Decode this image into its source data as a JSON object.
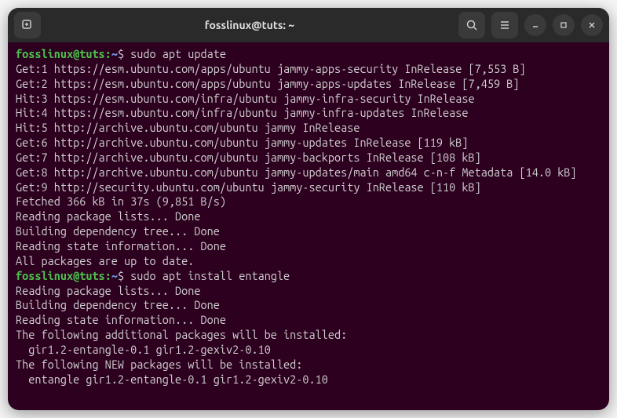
{
  "titlebar": {
    "title": "fosslinux@tuts: ~"
  },
  "prompt": {
    "user_host": "fosslinux@tuts",
    "colon": ":",
    "path": "~",
    "dollar": "$"
  },
  "commands": {
    "cmd1": " sudo apt update",
    "cmd2": " sudo apt install entangle"
  },
  "output": {
    "line1": "Get:1 https://esm.ubuntu.com/apps/ubuntu jammy-apps-security InRelease [7,553 B]",
    "line2": "Get:2 https://esm.ubuntu.com/apps/ubuntu jammy-apps-updates InRelease [7,459 B]",
    "line3": "Hit:3 https://esm.ubuntu.com/infra/ubuntu jammy-infra-security InRelease",
    "line4": "Hit:4 https://esm.ubuntu.com/infra/ubuntu jammy-infra-updates InRelease",
    "line5": "Hit:5 http://archive.ubuntu.com/ubuntu jammy InRelease",
    "line6": "Get:6 http://archive.ubuntu.com/ubuntu jammy-updates InRelease [119 kB]",
    "line7": "Get:7 http://archive.ubuntu.com/ubuntu jammy-backports InRelease [108 kB]",
    "line8": "Get:8 http://archive.ubuntu.com/ubuntu jammy-updates/main amd64 c-n-f Metadata [14.0 kB]",
    "line9": "Get:9 http://security.ubuntu.com/ubuntu jammy-security InRelease [110 kB]",
    "line10": "Fetched 366 kB in 37s (9,851 B/s)",
    "line11": "Reading package lists... Done",
    "line12": "Building dependency tree... Done",
    "line13": "Reading state information... Done",
    "line14": "All packages are up to date.",
    "line15": "Reading package lists... Done",
    "line16": "Building dependency tree... Done",
    "line17": "Reading state information... Done",
    "line18": "The following additional packages will be installed:",
    "line19": "  gir1.2-entangle-0.1 gir1.2-gexiv2-0.10",
    "line20": "The following NEW packages will be installed:",
    "line21": "  entangle gir1.2-entangle-0.1 gir1.2-gexiv2-0.10"
  }
}
